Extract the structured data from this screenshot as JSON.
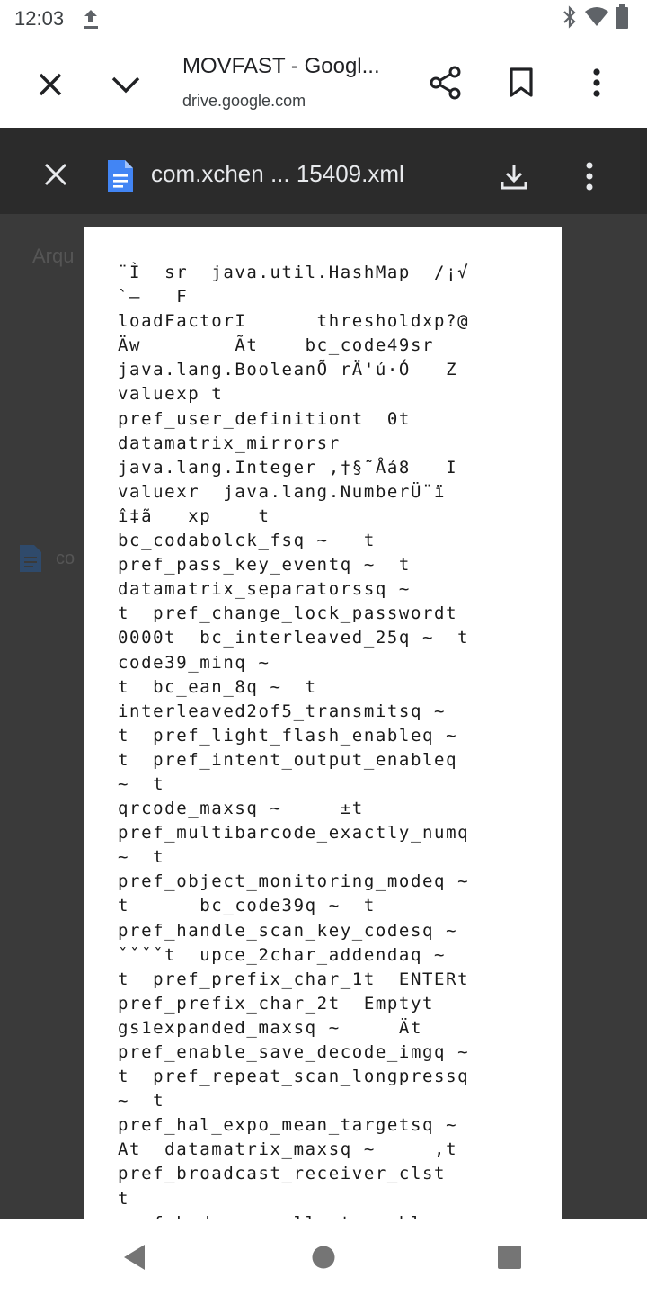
{
  "status_bar": {
    "time": "12:03",
    "icons": [
      "upload-icon",
      "bluetooth-icon",
      "wifi-icon",
      "battery-icon"
    ]
  },
  "toolbar": {
    "title": "MOVFAST - Googl...",
    "url": "drive.google.com",
    "icons": [
      "close-icon",
      "chevron-down-icon",
      "share-icon",
      "bookmark-icon",
      "more-vert-icon"
    ]
  },
  "viewer": {
    "filename": "com.xchen ... 15409.xml",
    "background_label": "Arqu",
    "background_file_label": "co",
    "icons": [
      "close-icon",
      "doc-icon",
      "download-icon",
      "more-vert-icon"
    ]
  },
  "document": {
    "lines": [
      "¨Ì  sr  java.util.HashMap  /¡√",
      "`–   F",
      "loadFactorI      thresholdxp?@",
      "Äw        Ãt    bc_code49sr",
      "java.lang.BooleanÕ rÄ'ú·Ó   Z",
      "valuexp t",
      "pref_user_definitiont  0t",
      "datamatrix_mirrorsr",
      "java.lang.Integer ,†§˜Åá8   I",
      "valuexr  java.lang.NumberÜ¨ï",
      "î‡ã   xp    t",
      "bc_codabolck_fsq ~   t",
      "pref_pass_key_eventq ~  t",
      "datamatrix_separatorssq ~",
      "t  pref_change_lock_passwordt",
      "0000t  bc_interleaved_25q ~  t",
      "code39_minq ~",
      "t  bc_ean_8q ~  t",
      "interleaved2of5_transmitsq ~",
      "t  pref_light_flash_enableq ~",
      "t  pref_intent_output_enableq",
      "~  t",
      "qrcode_maxsq ~     ±t",
      "pref_multibarcode_exactly_numq",
      "~  t",
      "pref_object_monitoring_modeq ~",
      "t      bc_code39q ~  t",
      "pref_handle_scan_key_codesq ~",
      "ˇˇˇˇt  upce_2char_addendaq ~",
      "t  pref_prefix_char_1t  ENTERt",
      "pref_prefix_char_2t  Emptyt",
      "gs1expanded_maxsq ~     Ät",
      "pref_enable_save_decode_imgq ~",
      "t  pref_repeat_scan_longpressq",
      "~  t",
      "pref_hal_expo_mean_targetsq ~",
      "At  datamatrix_maxsq ~     ,t",
      "pref_broadcast_receiver_clst",
      "t",
      "pref_badcase_collect_enableq ~"
    ]
  },
  "nav_bar": {
    "icons": [
      "back-icon",
      "home-icon",
      "recents-icon"
    ]
  },
  "colors": {
    "viewer_bg": "#3a3a3a",
    "viewer_header_bg": "#2b2b2b",
    "doc_icon_blue": "#4285f4"
  }
}
